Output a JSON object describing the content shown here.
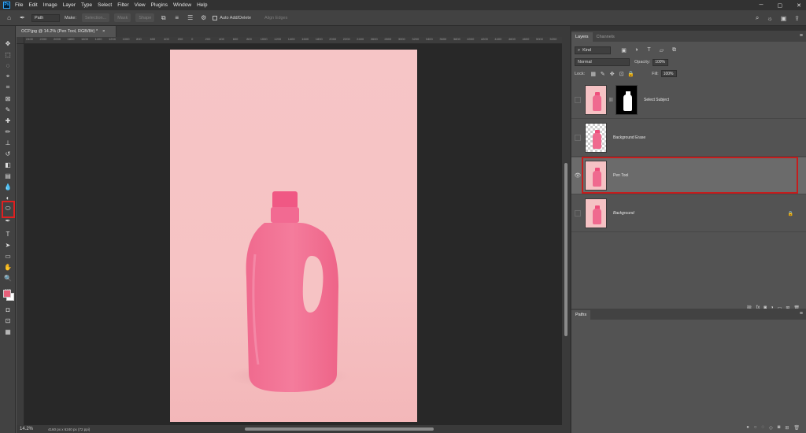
{
  "app": {
    "logo_text": "Ps"
  },
  "menu": [
    "File",
    "Edit",
    "Image",
    "Layer",
    "Type",
    "Select",
    "Filter",
    "View",
    "Plugins",
    "Window",
    "Help"
  ],
  "window_controls": [
    "─",
    "▢",
    "✕"
  ],
  "options_bar": {
    "mode_value": "Path",
    "make_label": "Make:",
    "selection_button": "Selection...",
    "mask_button": "Mask",
    "shape_button": "Shape",
    "auto_add_delete_label": "Auto Add/Delete",
    "align_edges_label": "Align Edges"
  },
  "document": {
    "tab_title": "OCP.jpg @ 14.2% (Pen Tool, RGB/8#) *",
    "close_glyph": "×"
  },
  "ruler_ticks": [
    "2400",
    "2200",
    "2000",
    "1800",
    "1600",
    "1400",
    "1200",
    "1000",
    "800",
    "600",
    "400",
    "200",
    "0",
    "200",
    "400",
    "600",
    "800",
    "1000",
    "1200",
    "1400",
    "1600",
    "1800",
    "2000",
    "2200",
    "2400",
    "2600",
    "2800",
    "3000",
    "3200",
    "3400",
    "3600",
    "3800",
    "4000",
    "4200",
    "4400",
    "4600",
    "4800",
    "5000",
    "5200"
  ],
  "status": {
    "zoom": "14.2%",
    "doc_size": "4160 px x 6240 px (72 ppi)"
  },
  "layers_panel": {
    "tabs": [
      "Layers",
      "Channels"
    ],
    "kind_filter": "Kind",
    "blend_mode": "Normal",
    "opacity_label": "Opacity:",
    "opacity_value": "100%",
    "lock_label": "Lock:",
    "fill_label": "Fill:",
    "fill_value": "100%",
    "layers": [
      {
        "name": "Select Subject",
        "visible": false,
        "has_mask": true,
        "selected": false
      },
      {
        "name": "Background Erase",
        "visible": false,
        "transparent": true,
        "selected": false
      },
      {
        "name": "Pen Tool",
        "visible": true,
        "selected": true
      },
      {
        "name": "Background",
        "visible": false,
        "locked": true,
        "selected": false
      }
    ]
  },
  "paths_panel": {
    "tab": "Paths"
  },
  "colors": {
    "foreground": "#e8607a",
    "background": "#ffffff",
    "highlight": "#e02020",
    "photo_bg": "#f6c5c6",
    "bottle": "#f07496"
  }
}
